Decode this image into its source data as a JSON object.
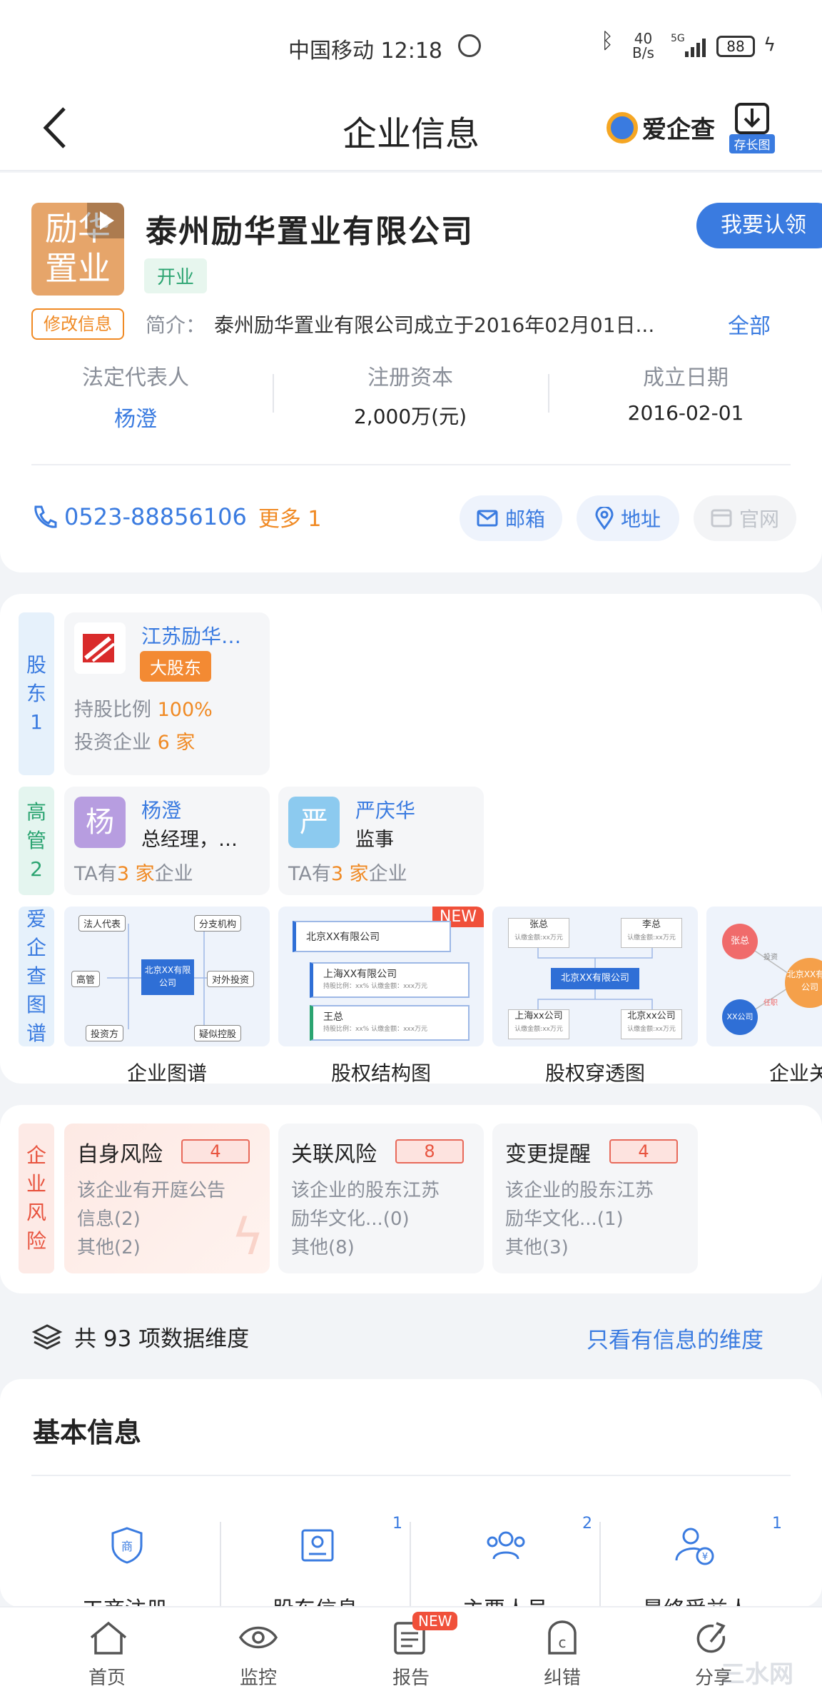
{
  "status_bar": {
    "carrier_time": "中国移动 12:18",
    "net_speed_top": "40",
    "net_speed_bottom": "B/s",
    "signal_label": "5G",
    "battery": "88"
  },
  "header": {
    "title": "企业信息",
    "brand": "爱企查",
    "save_long_image": "存长图"
  },
  "company": {
    "logo_line1": "励华",
    "logo_line2": "置业",
    "name": "泰州励华置业有限公司",
    "status": "开业",
    "claim_button": "我要认领",
    "edit_button": "修改信息",
    "intro_label": "简介：",
    "intro_text": "泰州励华置业有限公司成立于2016年02月01日...",
    "intro_more": "全部",
    "legal_rep_label": "法定代表人",
    "legal_rep_value": "杨澄",
    "capital_label": "注册资本",
    "capital_value": "2,000万(元)",
    "founded_label": "成立日期",
    "founded_value": "2016-02-01",
    "phone": "0523-88856106",
    "phone_more": "更多 1",
    "email": "邮箱",
    "address": "地址",
    "website": "官网"
  },
  "shareholders": {
    "side_label": [
      "股",
      "东",
      "1"
    ],
    "name": "江苏励华…",
    "badge": "大股东",
    "ratio_label": "持股比例",
    "ratio_value": "100%",
    "invest_label": "投资企业",
    "invest_value": "6 家"
  },
  "executives": {
    "side_label": [
      "高",
      "管",
      "2"
    ],
    "items": [
      {
        "avatar": "杨",
        "name": "杨澄",
        "role": "总经理，…",
        "ta_prefix": "TA有",
        "ta_count": "3 家",
        "ta_suffix": "企业"
      },
      {
        "avatar": "严",
        "name": "严庆华",
        "role": "监事",
        "ta_prefix": "TA有",
        "ta_count": "3 家",
        "ta_suffix": "企业"
      }
    ]
  },
  "graphs": {
    "side_label": [
      "爱",
      "企",
      "查",
      "图",
      "谱"
    ],
    "items": [
      {
        "caption": "企业图谱"
      },
      {
        "caption": "股权结构图"
      },
      {
        "caption": "股权穿透图"
      },
      {
        "caption": "企业关系"
      }
    ],
    "g1": {
      "center": "北京XX有限公司",
      "n1": "法人代表",
      "n2": "分支机构",
      "n3": "高管",
      "n4": "对外投资",
      "n5": "投资方",
      "n6": "疑似控股"
    },
    "g2": {
      "new": "NEW",
      "r1": "北京XX有限公司",
      "r2": "上海XX有限公司",
      "r2sub": "持股比例：xx%    认缴金额：xxx万元",
      "r3": "王总",
      "r3sub": "持股比例：xx%    认缴金额：xxx万元"
    },
    "g3": {
      "a": "张总",
      "asub": "认缴金额:xx万元",
      "b": "李总",
      "bsub": "认缴金额:xx万元",
      "center": "北京XX有限公司",
      "c": "上海xx公司",
      "csub": "认缴金额:xx万元",
      "d": "北京xx公司",
      "dsub": "认缴金额:xx万元"
    },
    "g4": {
      "a": "张总",
      "b": "XX公司",
      "c": "北京XX有限公司",
      "e1": "投资",
      "e2": "任职"
    }
  },
  "risks": {
    "side_label": [
      "企",
      "业",
      "风",
      "险"
    ],
    "items": [
      {
        "title": "自身风险",
        "count": "4",
        "line1": "该企业有开庭公告",
        "line2": "信息(2)",
        "line3": "其他(2)"
      },
      {
        "title": "关联风险",
        "count": "8",
        "line1": "该企业的股东江苏",
        "line2": "励华文化...(0)",
        "line3": "其他(8)"
      },
      {
        "title": "变更提醒",
        "count": "4",
        "line1": "该企业的股东江苏",
        "line2": "励华文化...(1)",
        "line3": "其他(3)"
      }
    ]
  },
  "dimensions": {
    "label": "共 93 项数据维度",
    "filter_link": "只看有信息的维度"
  },
  "basic_info": {
    "title": "基本信息",
    "items": [
      {
        "label": "工商注册",
        "count": ""
      },
      {
        "label": "股东信息",
        "count": "1"
      },
      {
        "label": "主要人员",
        "count": "2"
      },
      {
        "label": "最终受益人",
        "count": "1"
      }
    ]
  },
  "bottom_nav": {
    "items": [
      {
        "label": "首页"
      },
      {
        "label": "监控"
      },
      {
        "label": "报告",
        "badge": "NEW"
      },
      {
        "label": "纠错"
      },
      {
        "label": "分享"
      }
    ],
    "watermark": "三水网"
  },
  "colors": {
    "accent_blue": "#3a7be0",
    "orange": "#f08a24",
    "risk_red": "#e8533e",
    "green_status": "#2ba471"
  }
}
